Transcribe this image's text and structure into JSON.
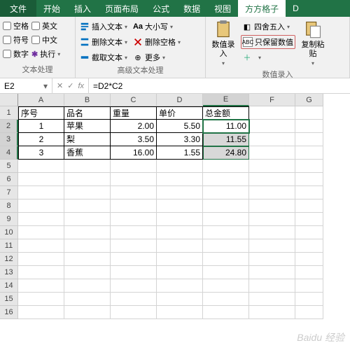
{
  "tabs": {
    "file": "文件",
    "items": [
      "开始",
      "插入",
      "页面布局",
      "公式",
      "数据",
      "视图",
      "方方格子",
      "D"
    ]
  },
  "ribbon": {
    "group1": {
      "label": "文本处理",
      "checks": [
        "空格",
        "英文",
        "符号",
        "中文",
        "数字",
        "执行"
      ]
    },
    "group2": {
      "label": "高级文本处理",
      "insert_text": "插入文本",
      "delete_text": "删除文本",
      "extract_text": "截取文本",
      "case": "大小写",
      "del_space": "删除空格",
      "more": "更多"
    },
    "group3": {
      "label": "数值录入",
      "input": "数值录入",
      "round": "四舍五入",
      "keep_value": "只保留数值",
      "paste": "复制粘贴"
    }
  },
  "formula_bar": {
    "name": "E2",
    "formula": "=D2*C2"
  },
  "cols": [
    "A",
    "B",
    "C",
    "D",
    "E",
    "F",
    "G"
  ],
  "table": {
    "headers": [
      "序号",
      "品名",
      "重量",
      "单价",
      "总金额"
    ],
    "rows": [
      {
        "no": "1",
        "name": "苹果",
        "weight": "2.00",
        "price": "5.50",
        "total": "11.00"
      },
      {
        "no": "2",
        "name": "梨",
        "weight": "3.50",
        "price": "3.30",
        "total": "11.55"
      },
      {
        "no": "3",
        "name": "香蕉",
        "weight": "16.00",
        "price": "1.55",
        "total": "24.80"
      }
    ]
  },
  "watermark": "Baidu 经验"
}
